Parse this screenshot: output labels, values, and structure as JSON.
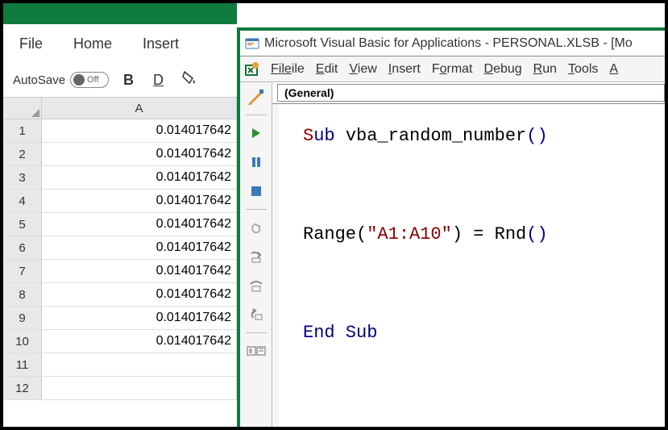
{
  "excel": {
    "menu": {
      "file": "File",
      "home": "Home",
      "insert": "Insert"
    },
    "toolbar": {
      "autosave_label": "AutoSave",
      "autosave_off": "Off",
      "bold": "B",
      "underline": "D"
    },
    "grid": {
      "col_a": "A",
      "rows": [
        {
          "num": "1",
          "val": "0.014017642"
        },
        {
          "num": "2",
          "val": "0.014017642"
        },
        {
          "num": "3",
          "val": "0.014017642"
        },
        {
          "num": "4",
          "val": "0.014017642"
        },
        {
          "num": "5",
          "val": "0.014017642"
        },
        {
          "num": "6",
          "val": "0.014017642"
        },
        {
          "num": "7",
          "val": "0.014017642"
        },
        {
          "num": "8",
          "val": "0.014017642"
        },
        {
          "num": "9",
          "val": "0.014017642"
        },
        {
          "num": "10",
          "val": "0.014017642"
        },
        {
          "num": "11",
          "val": ""
        },
        {
          "num": "12",
          "val": ""
        }
      ]
    }
  },
  "vbe": {
    "title": "Microsoft Visual Basic for Applications - PERSONAL.XLSB - [Mo",
    "menu": {
      "file": "File",
      "edit": "Edit",
      "view": "View",
      "insert": "Insert",
      "format": "Format",
      "debug": "Debug",
      "run": "Run",
      "tools": "Tools",
      "addins": "A"
    },
    "dropdown": {
      "general": "(General)"
    },
    "code": {
      "sub_kw": "Sub",
      "sub_name": "vba_random_number",
      "parens_open": "(",
      "parens_close": ")",
      "range_fn": "Range",
      "range_arg": "\"A1:A10\"",
      "equals": " = ",
      "rnd_fn": "Rnd",
      "end_sub": "End Sub",
      "s_letter": "S",
      "ub_letters": "ub"
    }
  }
}
